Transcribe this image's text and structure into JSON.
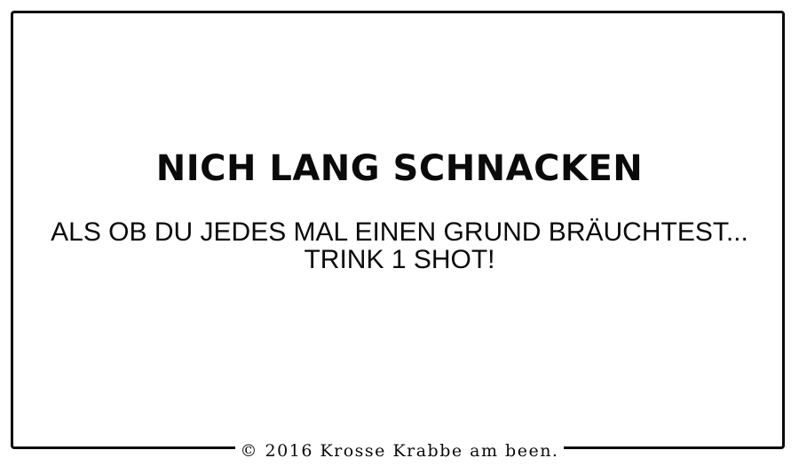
{
  "card": {
    "title": "NICH LANG SCHNACKEN",
    "body_line_1": "ALS OB DU JEDES MAL EINEN GRUND BRÄUCHTEST...",
    "body_line_2": "TRINK 1 SHOT!",
    "copyright": "© 2016 Krosse Krabbe am been."
  },
  "colors": {
    "ink": "#0a0a0a",
    "background": "#ffffff"
  }
}
